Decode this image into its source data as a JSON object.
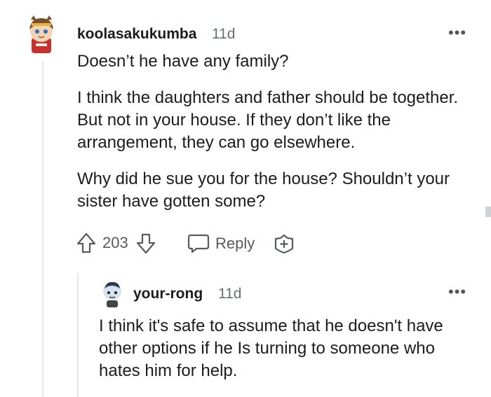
{
  "comment1": {
    "username": "koolasakukumba",
    "time": "11d",
    "paragraphs": [
      "Doesn’t he have any family?",
      "I think the daughters and father should be together. But not in your house. If they don’t like the arrangement, they can go elsewhere.",
      "Why did he sue you for the house? Shouldn’t your sister have gotten some?"
    ],
    "votes": "203",
    "reply_label": "Reply",
    "menu": "•••"
  },
  "comment2": {
    "username": "your-rong",
    "time": "11d",
    "paragraphs": [
      "I think it's safe to assume that he doesn't have other options if he Is turning to someone who hates him for help."
    ],
    "menu": "•••"
  }
}
